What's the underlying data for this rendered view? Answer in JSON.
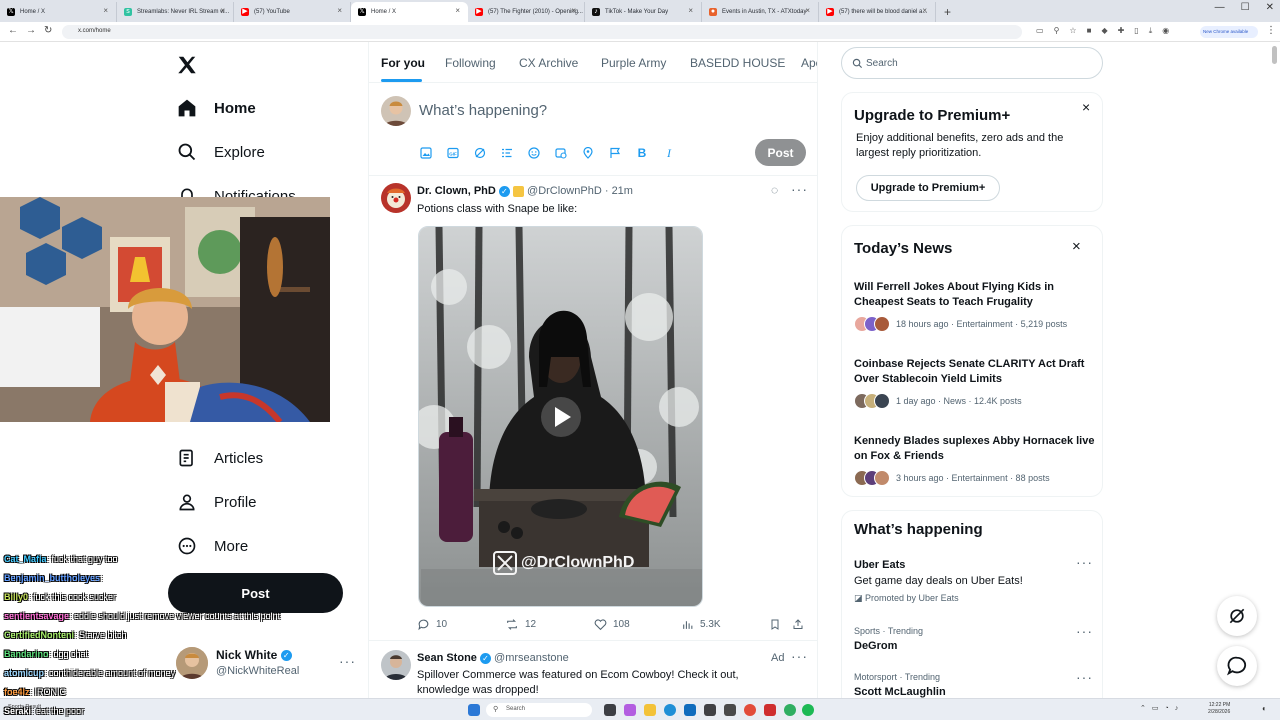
{
  "browser": {
    "tabs": [
      {
        "label": "Home / X",
        "icon": "x-logo-icon",
        "active": false
      },
      {
        "label": "Streamlabs: Never IRL Stream w...",
        "icon": "streamlabs-icon",
        "active": false
      },
      {
        "label": "(57) YouTube",
        "icon": "youtube-icon",
        "active": false
      },
      {
        "label": "Home / X",
        "icon": "x-logo-icon",
        "active": true
      },
      {
        "label": "(57) The Fighter (2010) - Opening...",
        "icon": "youtube-icon",
        "active": false
      },
      {
        "label": "TikTok - Make Your Day",
        "icon": "tiktok-icon",
        "active": false
      },
      {
        "label": "Events in Austin, TX - ATXtoday",
        "icon": "events-icon",
        "active": false
      },
      {
        "label": "(57) there will be blood daniel a...",
        "icon": "youtube-icon",
        "active": false
      }
    ],
    "new_tab": "+",
    "url": "x.com/home",
    "new_chrome_pill": "New Chrome available"
  },
  "sidebar": {
    "items": [
      {
        "label": "Home",
        "icon": "home-icon"
      },
      {
        "label": "Explore",
        "icon": "search-icon"
      },
      {
        "label": "Notifications",
        "icon": "bell-icon"
      },
      {
        "label": "Articles",
        "icon": "articles-icon"
      },
      {
        "label": "Profile",
        "icon": "profile-icon"
      },
      {
        "label": "More",
        "icon": "more-circle-icon"
      }
    ],
    "post_label": "Post",
    "account": {
      "name": "Nick White",
      "handle": "@NickWhiteReal"
    }
  },
  "chat": [
    {
      "user": "Cat_Mafia",
      "color": "#3ec9ff",
      "text": ": fuck that guy too"
    },
    {
      "user": "Benjamin_buttholeyes",
      "color": "#5f9cff",
      "text": ":"
    },
    {
      "user": "Billy0",
      "color": "#c7e35a",
      "text": ": fuck this cock sucker"
    },
    {
      "user": "sentientsavage",
      "color": "#ff6bd5",
      "text": ": eddie should just remove viewer counts at this point"
    },
    {
      "user": "CertifiedNonteni",
      "color": "#a8f06a",
      "text": ": Starve bitch"
    },
    {
      "user": "Bandarino",
      "color": "#5be07a",
      "text": ": dgg chat"
    },
    {
      "user": "atomicup",
      "color": "#9bd7ff",
      "text": ": conthiderable amount of money"
    },
    {
      "user": "foe4lz",
      "color": "#ff9a3c",
      "text": ": IRONIC"
    },
    {
      "user": "Seraki",
      "color": "#ffffff",
      "text": ": eat the poor"
    }
  ],
  "feed": {
    "tabs": [
      "For you",
      "Following",
      "CX Archive",
      "Purple Army",
      "BASEDD HOUSE",
      "Ape"
    ],
    "composer": {
      "placeholder": "What’s happening?",
      "icons": [
        "image-icon",
        "gif-icon",
        "grok-icon",
        "poll-icon",
        "emoji-icon",
        "schedule-icon",
        "location-icon",
        "flag-icon",
        "bold-icon",
        "italic-icon"
      ],
      "post_label": "Post"
    },
    "tweet1": {
      "name": "Dr. Clown, PhD",
      "handle": "@DrClownPhD",
      "time": "· 21m",
      "text": "Potions class with Snape be like:",
      "watermark": "@DrClownPhD",
      "replies": "10",
      "reposts": "12",
      "likes": "108",
      "views": "5.3K"
    },
    "tweet2": {
      "name": "Sean Stone",
      "handle": "@mrseanstone",
      "ad": "Ad",
      "text": "Spillover Commerce was featured on Ecom Cowboy! Check it out, knowledge was dropped!"
    }
  },
  "right": {
    "search_placeholder": "Search",
    "premium": {
      "title": "Upgrade to Premium+",
      "body": "Enjoy additional benefits, zero ads and the largest reply prioritization.",
      "button": "Upgrade to Premium+"
    },
    "news": {
      "title": "Today’s News",
      "items": [
        {
          "title": "Will Ferrell Jokes About Flying Kids in Cheapest Seats to Teach Frugality",
          "meta": "18 hours ago · Entertainment · 5,219 posts"
        },
        {
          "title": "Coinbase Rejects Senate CLARITY Act Draft Over Stablecoin Yield Limits",
          "meta": "1 day ago · News · 12.4K posts"
        },
        {
          "title": "Kennedy Blades suplexes Abby Hornacek live on Fox & Friends",
          "meta": "3 hours ago · Entertainment · 88 posts"
        }
      ]
    },
    "happening": {
      "title": "What’s happening",
      "items": [
        {
          "name": "Uber Eats",
          "desc": "Get game day deals on Uber Eats!",
          "promo": "Promoted by Uber Eats"
        },
        {
          "sub": "Sports · Trending",
          "name": "DeGrom"
        },
        {
          "sub": "Motorsport · Trending",
          "name": "Scott McLaughlin"
        }
      ]
    }
  },
  "taskbar": {
    "weather": "Sports Result",
    "search": "Search",
    "time": "12:22 PM",
    "date": "2/28/2026"
  },
  "colors": {
    "accent": "#1d9bf0",
    "text": "#0f1419",
    "muted": "#536471"
  }
}
